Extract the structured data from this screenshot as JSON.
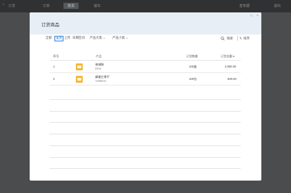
{
  "app": {
    "back_label": "订货",
    "tabs": [
      "订单",
      "拣货",
      "装车"
    ],
    "right_items": [
      "查单据",
      "退出"
    ]
  },
  "modal": {
    "title": "订货商品",
    "filters": [
      "全部",
      "本月",
      "上月",
      "日期区间",
      "产品大类",
      "产品小类"
    ],
    "active_filter": "本月",
    "search_label": "搜索",
    "sort_label": "排序",
    "columns": {
      "index": "序号",
      "product": "产品",
      "quantity": "订货数量",
      "amount": "订货金额"
    },
    "rows": [
      {
        "index": "1",
        "name": "香辣酥",
        "sub": "DHS",
        "quantity": "100盒",
        "amount": "2,900.00"
      },
      {
        "index": "2",
        "name": "蜂蜜芒果干",
        "sub": "YDMGG",
        "quantity": "100包",
        "amount": "600.00"
      }
    ]
  },
  "colors": {
    "accent": "#2a7bd8",
    "modal_header": "#e7eef5",
    "topbar": "#2f3133"
  }
}
